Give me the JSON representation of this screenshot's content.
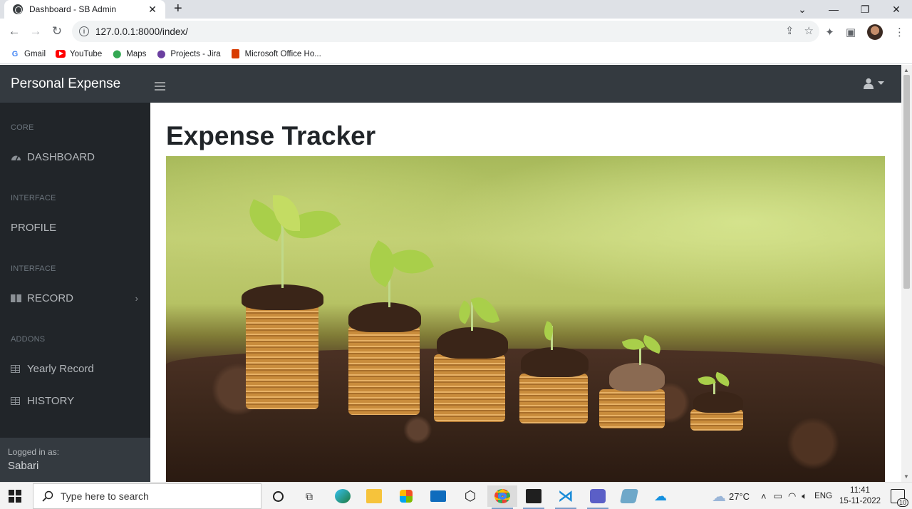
{
  "browser": {
    "tab_title": "Dashboard - SB Admin",
    "tab_close": "✕",
    "new_tab": "+",
    "url": "127.0.0.1:8000/index/",
    "bookmarks": [
      {
        "label": "Gmail",
        "icon": "gmail-icon",
        "color": "#ea4335"
      },
      {
        "label": "YouTube",
        "icon": "youtube-icon",
        "color": "#ff0000"
      },
      {
        "label": "Maps",
        "icon": "maps-icon",
        "color": "#34a853"
      },
      {
        "label": "Projects - Jira",
        "icon": "jira-icon",
        "color": "#6b3fa0"
      },
      {
        "label": "Microsoft Office Ho...",
        "icon": "office-icon",
        "color": "#d83b01"
      }
    ]
  },
  "app": {
    "brand": "Personal Expense",
    "sidebar": {
      "headings": [
        "CORE",
        "INTERFACE",
        "INTERFACE",
        "ADDONS"
      ],
      "items": [
        {
          "label": "DASHBOARD",
          "icon": "tachometer-icon"
        },
        {
          "label": "PROFILE"
        },
        {
          "label": "RECORD",
          "icon": "columns-icon",
          "chevron": "›"
        },
        {
          "label": "Yearly Record",
          "icon": "table-icon"
        },
        {
          "label": "HISTORY",
          "icon": "table-icon"
        }
      ],
      "footer_label": "Logged in as:",
      "footer_user": "Sabari"
    },
    "page_title": "Expense Tracker"
  },
  "taskbar": {
    "search_placeholder": "Type here to search",
    "weather": "27°C",
    "lang": "ENG",
    "time": "11:41",
    "date": "15-11-2022",
    "notifications": "10"
  },
  "colors": {
    "topnav": "#343a40",
    "sidebar": "#212529",
    "accent": "#0d6efd"
  }
}
